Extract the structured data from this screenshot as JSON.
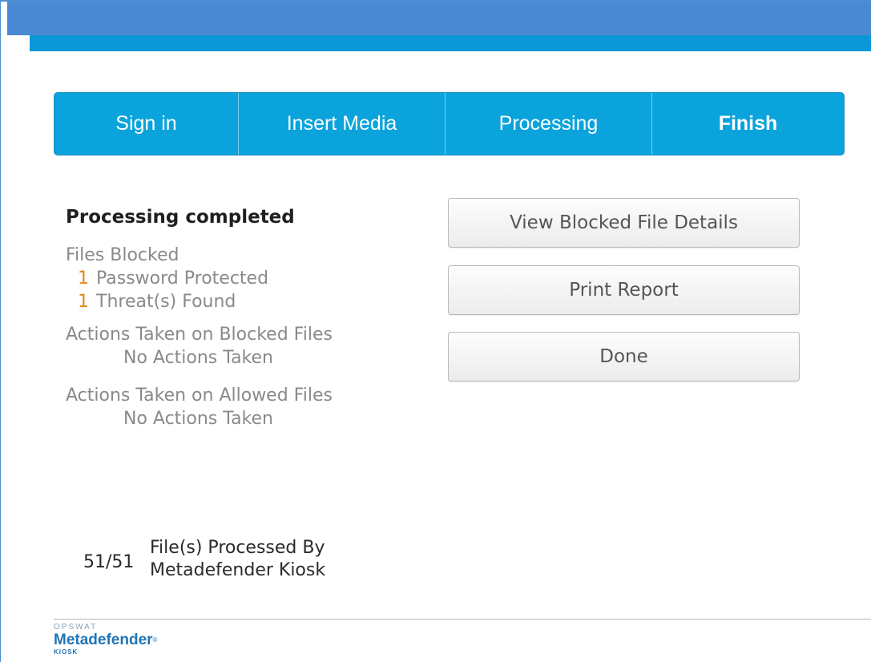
{
  "steps": [
    {
      "label": "Sign in",
      "active": false
    },
    {
      "label": "Insert Media",
      "active": false
    },
    {
      "label": "Processing",
      "active": false
    },
    {
      "label": "Finish",
      "active": true
    }
  ],
  "summary": {
    "heading": "Processing completed",
    "files_blocked_label": "Files Blocked",
    "blocked_items": [
      {
        "count": "1",
        "label": "Password Protected"
      },
      {
        "count": "1",
        "label": "Threat(s) Found"
      }
    ],
    "blocked_actions_label": "Actions Taken on Blocked Files",
    "blocked_actions_value": "No Actions Taken",
    "allowed_actions_label": "Actions Taken on Allowed Files",
    "allowed_actions_value": "No Actions Taken"
  },
  "buttons": {
    "view_details": "View Blocked File Details",
    "print_report": "Print Report",
    "done": "Done"
  },
  "processed": {
    "ratio": "51/51",
    "line1": "File(s) Processed By",
    "line2": "Metadefender Kiosk"
  },
  "logo": {
    "top": "OPSWAT",
    "brand": "Metadefender",
    "registered": "®",
    "sub": "KIOSK"
  },
  "colors": {
    "step_bar": "#0aa3dc",
    "header": "#4a8ad4",
    "accent_number": "#e3891c"
  }
}
